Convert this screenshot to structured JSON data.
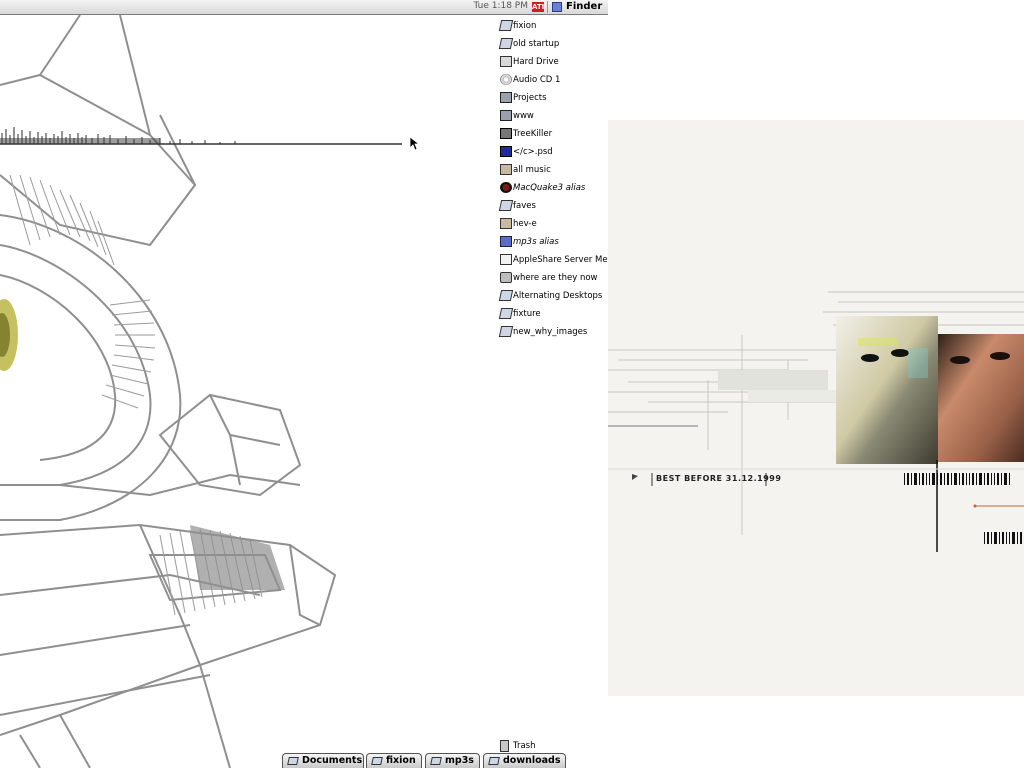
{
  "menubar": {
    "clock": "Tue 1:18 PM",
    "app_menu": "Finder",
    "badge_color": "#d61b1b",
    "finder_icon": "finder-face-icon"
  },
  "desktop": {
    "icons": [
      {
        "label": "fixion",
        "icon": "disk-icon",
        "alias": false
      },
      {
        "label": "old startup",
        "icon": "disk-icon",
        "alias": false
      },
      {
        "label": "Hard Drive",
        "icon": "hard-drive-icon",
        "alias": false
      },
      {
        "label": "Audio CD 1",
        "icon": "cd-icon",
        "alias": false
      },
      {
        "label": "Projects",
        "icon": "folder-icon",
        "alias": false
      },
      {
        "label": "www",
        "icon": "folder-icon",
        "alias": false
      },
      {
        "label": "TreeKiller",
        "icon": "application-icon",
        "alias": false
      },
      {
        "label": "</c>.psd",
        "icon": "photoshop-document-icon",
        "alias": false
      },
      {
        "label": "all music",
        "icon": "music-folder-icon",
        "alias": false
      },
      {
        "label": "MacQuake3 alias",
        "icon": "quake-icon",
        "alias": true
      },
      {
        "label": "faves",
        "icon": "disk-icon",
        "alias": false
      },
      {
        "label": "hev-e",
        "icon": "music-folder-icon",
        "alias": false
      },
      {
        "label": "mp3s alias",
        "icon": "mp3-folder-icon",
        "alias": true
      },
      {
        "label": "AppleShare Server Messages",
        "icon": "document-icon",
        "alias": false
      },
      {
        "label": "where are they now",
        "icon": "printer-icon",
        "alias": false
      },
      {
        "label": "Alternating Desktops",
        "icon": "disk-icon",
        "alias": false
      },
      {
        "label": "fixture",
        "icon": "disk-icon",
        "alias": false
      },
      {
        "label": "new_why_images",
        "icon": "disk-icon",
        "alias": false
      }
    ],
    "trash_label": "Trash"
  },
  "popup_tabs": [
    {
      "label": "Documents"
    },
    {
      "label": "fixion"
    },
    {
      "label": "mp3s"
    },
    {
      "label": "downloads"
    }
  ],
  "second_display": {
    "wallpaper_text": "BEST BEFORE 31.12.1999"
  }
}
